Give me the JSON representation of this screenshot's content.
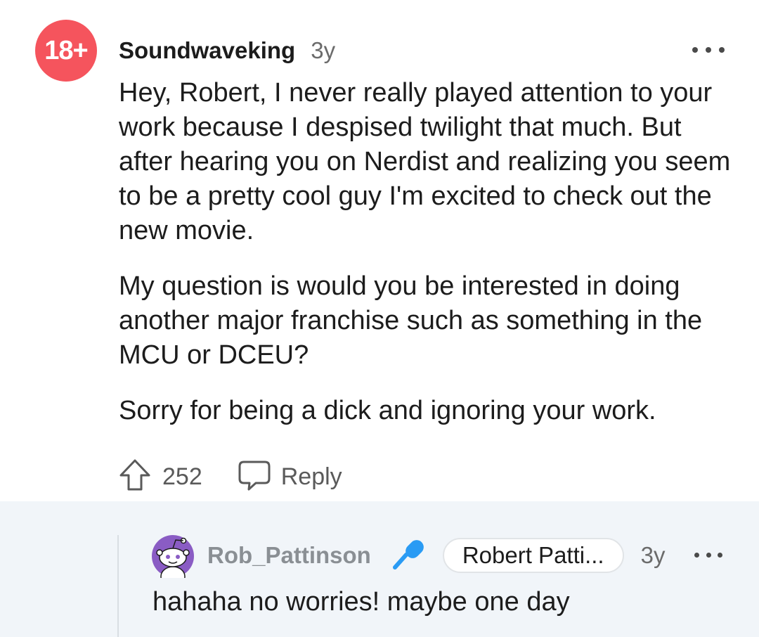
{
  "comment": {
    "avatar_text": "18+",
    "username": "Soundwaveking",
    "age": "3y",
    "paragraphs": [
      "Hey, Robert, I never really played attention to your work because I despised twilight that much. But after hearing you on Nerdist and realizing you seem to be a pretty cool guy I'm excited to check out the new movie.",
      "My question is would you be interested in doing another major franchise such as something in the MCU or DCEU?",
      "Sorry for being a dick and ignoring your work."
    ],
    "votes": "252",
    "reply_label": "Reply"
  },
  "reply": {
    "username": "Rob_Pattinson",
    "flair": "Robert Patti...",
    "age": "3y",
    "text": "hahaha no worries! maybe one day"
  },
  "colors": {
    "avatar_bg": "#f5545d",
    "mic": "#2a9bf4",
    "reply_bg": "#f1f5f9",
    "snoo_bg": "#8a5cc4"
  },
  "icons": [
    "more-icon",
    "upvote-icon",
    "comment-icon",
    "snoo-avatar-icon",
    "microphone-icon"
  ]
}
